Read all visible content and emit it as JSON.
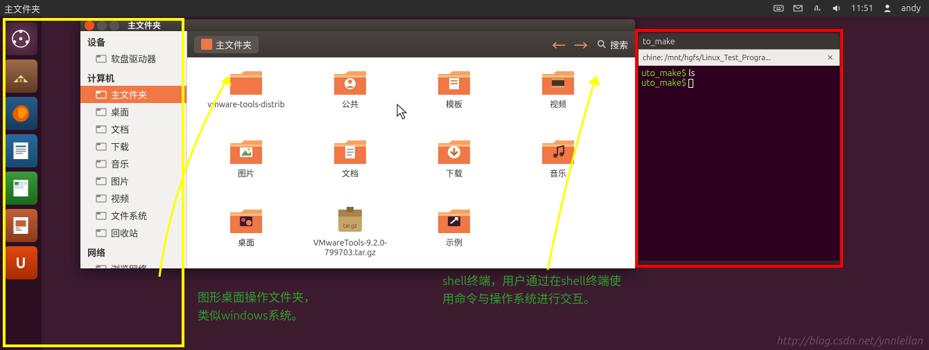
{
  "top_panel": {
    "title": "主文件夹",
    "time": "11:51",
    "user": "andy"
  },
  "fm": {
    "title": "主文件夹",
    "crumb": "主文件夹",
    "search": "搜索",
    "sidebar": {
      "sections": [
        {
          "head": "设备",
          "items": [
            {
              "label": "软盘驱动器",
              "icon": "disk"
            }
          ]
        },
        {
          "head": "计算机",
          "items": [
            {
              "label": "主文件夹",
              "icon": "home",
              "active": true
            },
            {
              "label": "桌面",
              "icon": "desktop"
            },
            {
              "label": "文档",
              "icon": "doc"
            },
            {
              "label": "下载",
              "icon": "download"
            },
            {
              "label": "音乐",
              "icon": "music"
            },
            {
              "label": "图片",
              "icon": "pic"
            },
            {
              "label": "视频",
              "icon": "video"
            },
            {
              "label": "文件系统",
              "icon": "fs"
            },
            {
              "label": "回收站",
              "icon": "trash"
            }
          ]
        },
        {
          "head": "网络",
          "items": [
            {
              "label": "浏览网络",
              "icon": "net"
            }
          ]
        }
      ]
    },
    "items": [
      {
        "label": "vmware-tools-distrib",
        "type": "folder"
      },
      {
        "label": "公共",
        "type": "folder-share"
      },
      {
        "label": "模板",
        "type": "folder-template"
      },
      {
        "label": "视频",
        "type": "folder-video"
      },
      {
        "label": "图片",
        "type": "folder-pic"
      },
      {
        "label": "文档",
        "type": "folder-doc"
      },
      {
        "label": "下载",
        "type": "folder-download"
      },
      {
        "label": "音乐",
        "type": "folder-music"
      },
      {
        "label": "桌面",
        "type": "folder-desktop"
      },
      {
        "label": "VMwareTools-9.2.0-799703.tar.gz",
        "type": "archive"
      },
      {
        "label": "示例",
        "type": "folder-link"
      }
    ]
  },
  "terminal": {
    "title1": "to_make",
    "tab": "chine: /mnt/hgfs/Linux_Test_Progra...",
    "line1_prompt": "uto_make$ ",
    "line1_cmd": "ls",
    "line2_prompt": "uto_make$ "
  },
  "annotations": {
    "left": "图形桌面操作文件夹，类似windows系统。",
    "right": "shell终端，用户通过在shell终端使用命令与操作系统进行交互。"
  },
  "watermark": "http://blog.csdn.net/ynnlellan"
}
